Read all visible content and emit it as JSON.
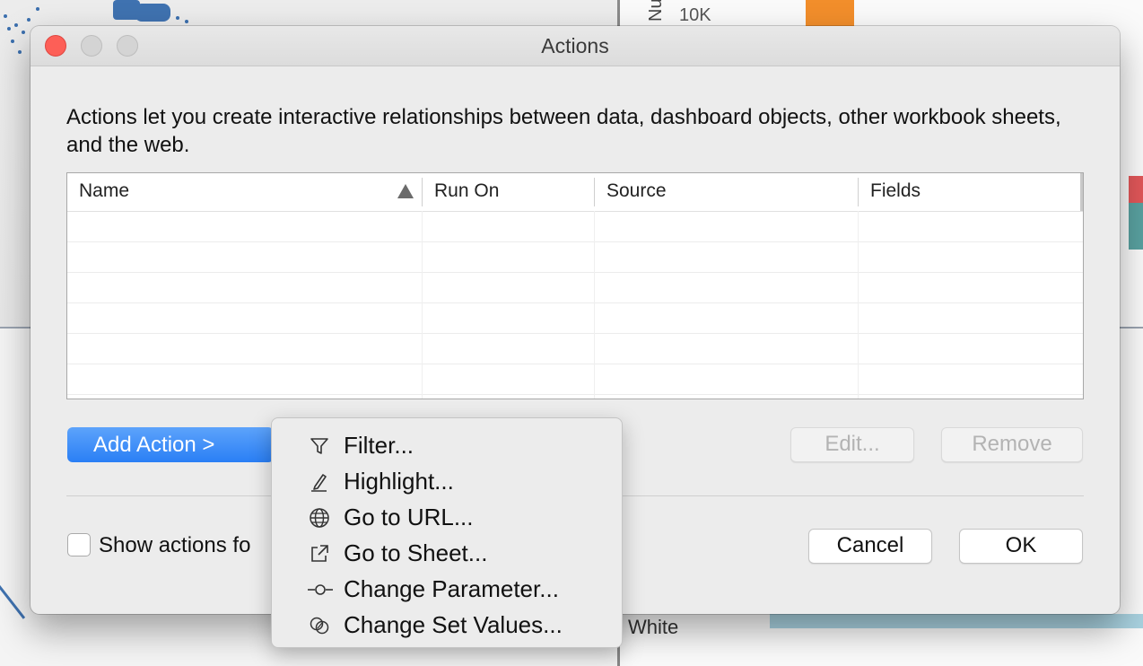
{
  "background": {
    "axis_label": "Nu",
    "tick_label": "10K",
    "white_label": "White"
  },
  "dialog": {
    "title": "Actions",
    "description": "Actions let you create interactive relationships between data, dashboard objects, other workbook sheets, and the web.",
    "table": {
      "columns": [
        "Name",
        "Run On",
        "Source",
        "Fields"
      ],
      "sort_column": "Name",
      "sort_direction": "ascending",
      "rows": []
    },
    "buttons": {
      "add_action": "Add Action >",
      "edit": "Edit...",
      "remove": "Remove",
      "cancel": "Cancel",
      "ok": "OK"
    },
    "show_actions_checkbox": {
      "label": "Show actions fo",
      "checked": false
    }
  },
  "add_action_menu": {
    "items": [
      {
        "label": "Filter...",
        "icon": "filter-icon"
      },
      {
        "label": "Highlight...",
        "icon": "highlight-pen-icon"
      },
      {
        "label": "Go to URL...",
        "icon": "globe-icon"
      },
      {
        "label": "Go to Sheet...",
        "icon": "external-link-icon"
      },
      {
        "label": "Change Parameter...",
        "icon": "parameter-icon"
      },
      {
        "label": "Change Set Values...",
        "icon": "set-values-icon"
      }
    ]
  },
  "colors": {
    "accent_blue": "#2a7ff5",
    "close_red": "#fd5f57",
    "dialog_bg": "#ececec"
  }
}
